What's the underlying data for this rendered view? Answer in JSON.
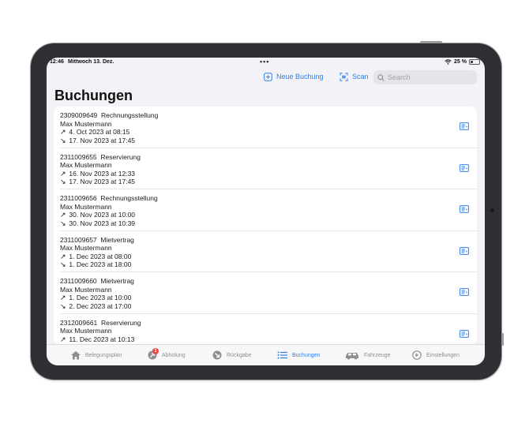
{
  "status_bar": {
    "time": "12:46",
    "date": "Mittwoch 13. Dez.",
    "battery": "25 %"
  },
  "toolbar": {
    "new_booking_label": "Neue Buchung",
    "scan_label": "Scan",
    "search_placeholder": "Search"
  },
  "page": {
    "title": "Buchungen"
  },
  "bookings": [
    {
      "number": "2309009649",
      "type": "Rechnungsstellung",
      "customer": "Max Mustermann",
      "pickup": "4. Oct 2023 at 08:15",
      "return": "17. Nov 2023 at 17:45"
    },
    {
      "number": "2311009655",
      "type": "Reservierung",
      "customer": "Max Mustermann",
      "pickup": "16. Nov 2023 at 12:33",
      "return": "17. Nov 2023 at 17:45"
    },
    {
      "number": "2311009656",
      "type": "Rechnungsstellung",
      "customer": "Max Mustermann",
      "pickup": "30. Nov 2023 at 10:00",
      "return": "30. Nov 2023 at 10:39"
    },
    {
      "number": "2311009657",
      "type": "Mietvertrag",
      "customer": "Max Mustermann",
      "pickup": "1. Dec 2023 at 08:00",
      "return": "1. Dec 2023 at 18:00"
    },
    {
      "number": "2311009660",
      "type": "Mietvertrag",
      "customer": "Max Mustermann",
      "pickup": "1. Dec 2023 at 10:00",
      "return": "2. Dec 2023 at 17:00"
    },
    {
      "number": "2312009661",
      "type": "Reservierung",
      "customer": "Max Mustermann",
      "pickup": "11. Dec 2023 at 10:13",
      "return": ""
    }
  ],
  "tabs": [
    {
      "label": "Belegungsplan",
      "icon": "house-icon"
    },
    {
      "label": "Abholung",
      "icon": "pickup-arrow-icon",
      "badge": "1"
    },
    {
      "label": "Rückgabe",
      "icon": "return-arrow-icon"
    },
    {
      "label": "Buchungen",
      "icon": "list-icon",
      "active": true
    },
    {
      "label": "Fahrzeuge",
      "icon": "car-icon"
    },
    {
      "label": "Einstellungen",
      "icon": "settings-icon"
    }
  ],
  "colors": {
    "accent": "#2f80ed",
    "badge": "#e8453c",
    "background": "#f2f2f7"
  }
}
